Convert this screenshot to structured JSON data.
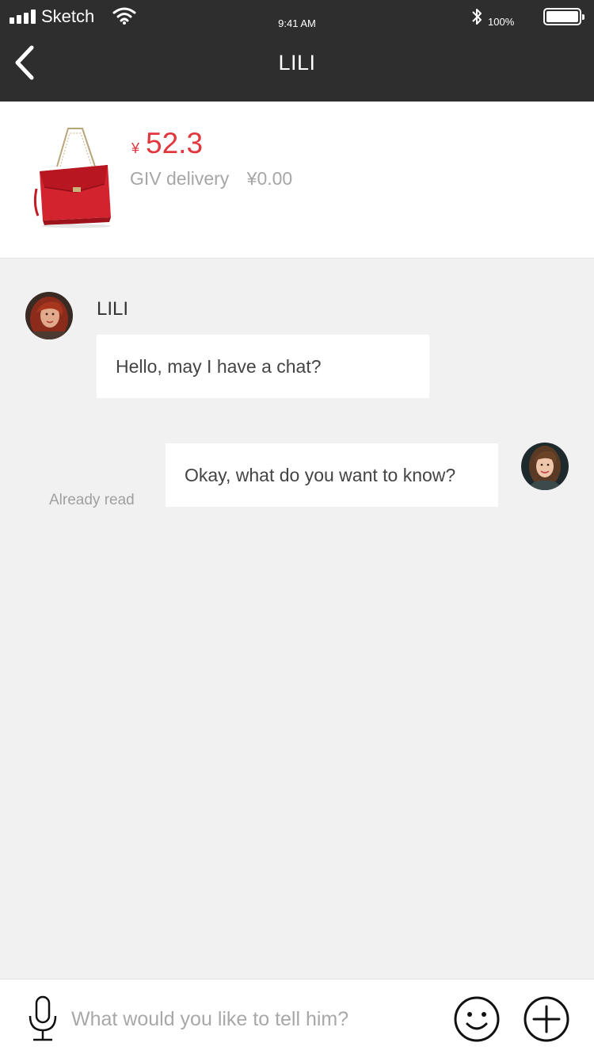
{
  "status_bar": {
    "carrier": "Sketch",
    "time": "9:41 AM",
    "battery_percent": "100%",
    "battery_level": 1.0,
    "icons": [
      "signal-icon",
      "wifi-icon",
      "bluetooth-icon",
      "battery-icon"
    ]
  },
  "nav": {
    "back_icon": "chevron-left-icon",
    "title": "LILI"
  },
  "product": {
    "image": "red-handbag-image",
    "currency_symbol": "¥",
    "price": "52.3",
    "delivery_label": "GIV delivery",
    "delivery_fee": "¥0.00"
  },
  "chat": {
    "messages": [
      {
        "side": "left",
        "sender": "LILI",
        "text": "Hello, may I have a chat?"
      },
      {
        "side": "right",
        "text": "Okay, what do you want to know?",
        "status": "Already read"
      }
    ]
  },
  "input_bar": {
    "placeholder": "What would you like to tell him?",
    "value": "",
    "icons": [
      "microphone-icon",
      "emoji-icon",
      "plus-icon"
    ]
  },
  "colors": {
    "header_bg": "#2e2e2e",
    "price_red": "#e0383e",
    "chat_bg": "#f1f1f1"
  }
}
